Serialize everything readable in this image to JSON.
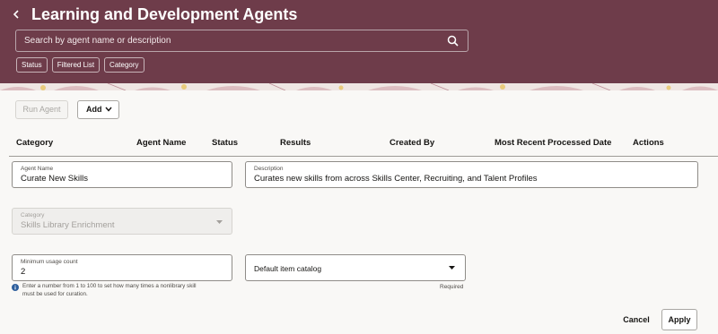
{
  "header": {
    "title": "Learning and Development Agents",
    "search_placeholder": "Search by agent name or description",
    "filters": [
      "Status",
      "Filtered List",
      "Category"
    ],
    "background_color": "#6e3c4a"
  },
  "toolbar": {
    "run_label": "Run Agent",
    "add_label": "Add"
  },
  "table": {
    "columns": [
      "Category",
      "Agent Name",
      "Status",
      "Results",
      "Created By",
      "Most Recent Processed Date",
      "Actions"
    ]
  },
  "form": {
    "agent_name": {
      "label": "Agent Name",
      "value": "Curate New Skills"
    },
    "description": {
      "label": "Description",
      "value": "Curates new skills from across Skills Center, Recruiting, and Talent Profiles"
    },
    "category": {
      "label": "Category",
      "value": "Skills Library Enrichment"
    },
    "min_usage": {
      "label": "Minimum usage count",
      "value": "2",
      "help_line1": "Enter a number from 1 to 100 to set how many times a nonlibrary skill",
      "help_line2": "must be used for curation."
    },
    "catalog": {
      "label": "Default item catalog",
      "required": "Required"
    }
  },
  "footer": {
    "cancel_label": "Cancel",
    "apply_label": "Apply"
  }
}
